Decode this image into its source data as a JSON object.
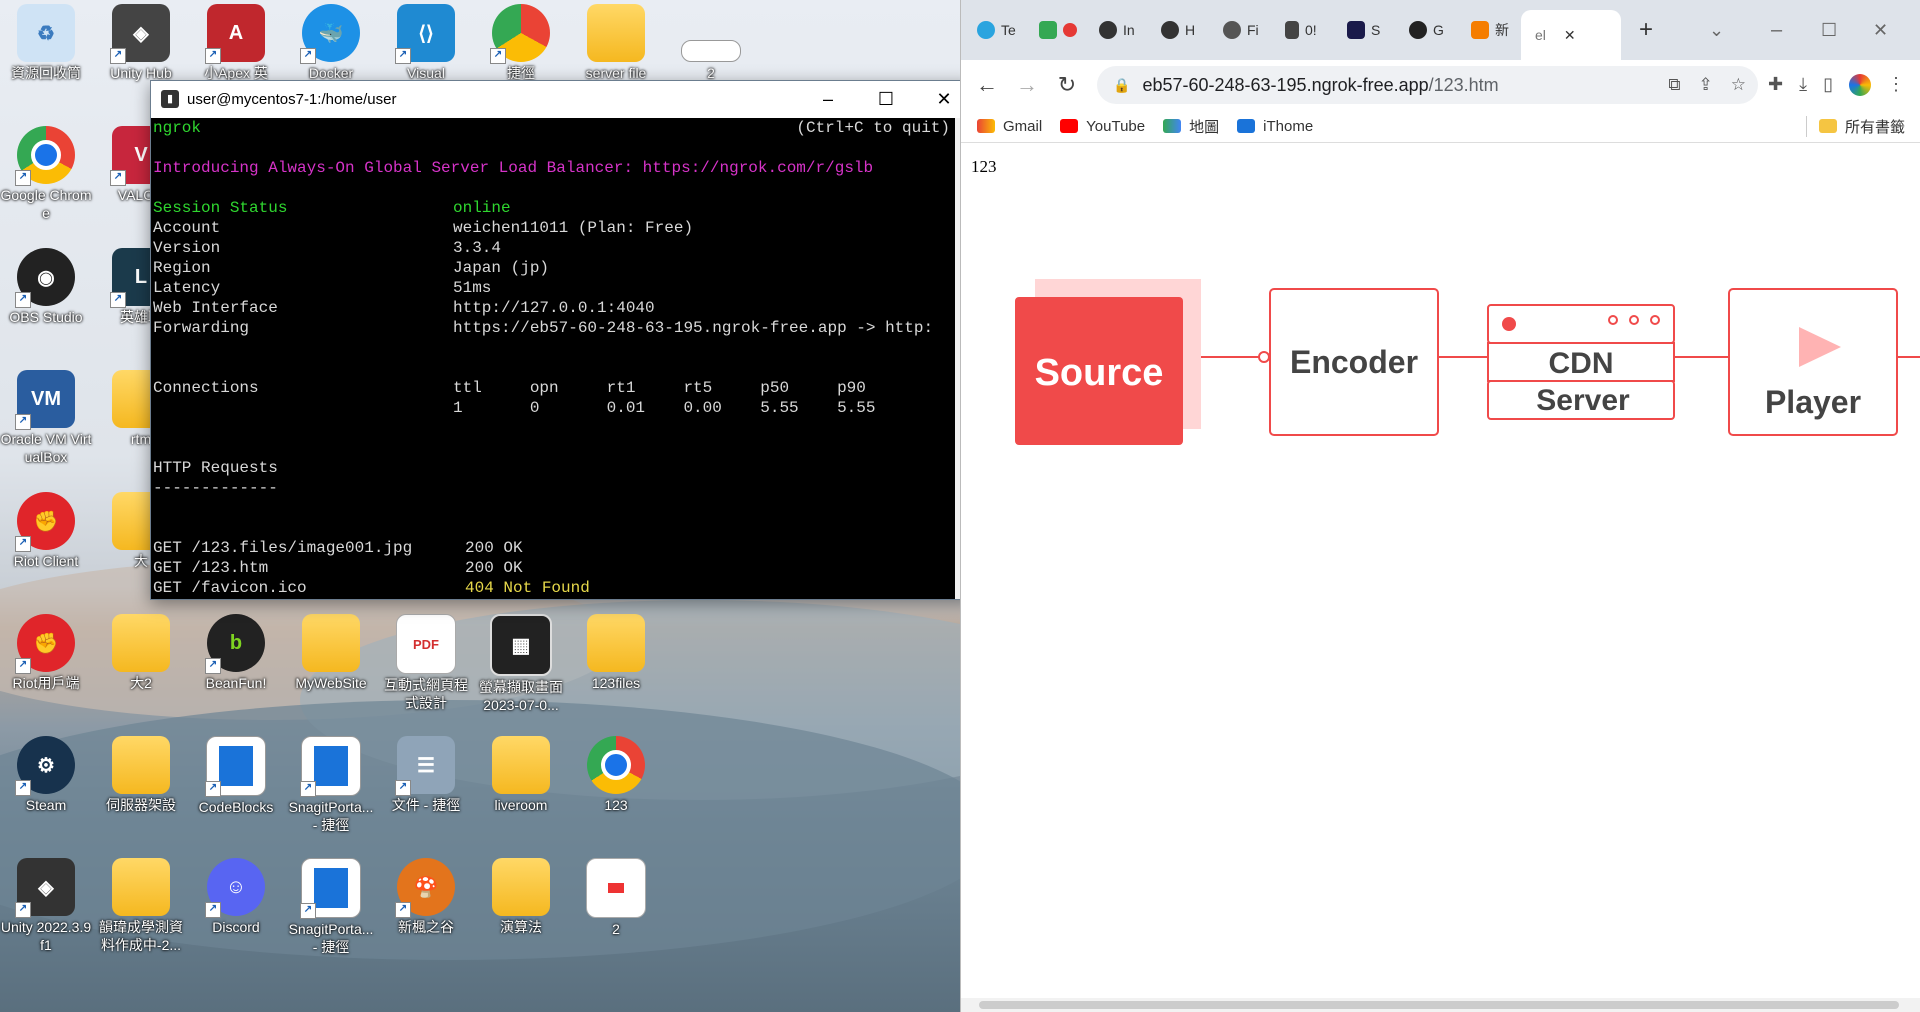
{
  "desktop": {
    "icons": [
      {
        "label": "資源回收筒"
      },
      {
        "label": "Unity Hub"
      },
      {
        "label": "小Apex 英"
      },
      {
        "label": "Docker"
      },
      {
        "label": "Visual"
      },
      {
        "label": "捷徑"
      },
      {
        "label": "server file"
      },
      {
        "label": "2"
      },
      {
        "label": "Google Chrome"
      },
      {
        "label": "VALOR"
      },
      {
        "label": "OBS Studio"
      },
      {
        "label": "英雄聯"
      },
      {
        "label": "Oracle VM VirtualBox"
      },
      {
        "label": "rtm"
      },
      {
        "label": "Riot Client"
      },
      {
        "label": "大"
      },
      {
        "label": "Riot用戶端"
      },
      {
        "label": "大2"
      },
      {
        "label": "BeanFun!"
      },
      {
        "label": "MyWebSite"
      },
      {
        "label": "互動式網頁程式設計"
      },
      {
        "label": "螢幕擷取畫面 2023-07-0..."
      },
      {
        "label": "123files"
      },
      {
        "label": "Steam"
      },
      {
        "label": "伺服器架設"
      },
      {
        "label": "CodeBlocks"
      },
      {
        "label": "SnagitPorta... - 捷徑"
      },
      {
        "label": "文件 - 捷徑"
      },
      {
        "label": "liveroom"
      },
      {
        "label": "123"
      },
      {
        "label": "Unity 2022.3.9f1"
      },
      {
        "label": "韻瑋成學測資料作成中-2..."
      },
      {
        "label": "Discord"
      },
      {
        "label": "SnagitPorta... - 捷徑"
      },
      {
        "label": "新楓之谷"
      },
      {
        "label": "演算法"
      },
      {
        "label": "2"
      }
    ]
  },
  "terminal": {
    "title": "user@mycentos7-1:/home/user",
    "app": "ngrok",
    "quit_hint": "(Ctrl+C to quit)",
    "announcement": "Introducing Always-On Global Server Load Balancer: https://ngrok.com/r/gslb",
    "rows": [
      {
        "k": "Session Status",
        "v": "online"
      },
      {
        "k": "Account",
        "v": "weichen11011 (Plan: Free)"
      },
      {
        "k": "Version",
        "v": "3.3.4"
      },
      {
        "k": "Region",
        "v": "Japan (jp)"
      },
      {
        "k": "Latency",
        "v": "51ms"
      },
      {
        "k": "Web Interface",
        "v": "http://127.0.0.1:4040"
      },
      {
        "k": "Forwarding",
        "v": "https://eb57-60-248-63-195.ngrok-free.app -> http:"
      }
    ],
    "connections_label": "Connections",
    "conn_headers": "ttl     opn     rt1     rt5     p50     p90",
    "conn_values": "1       0       0.01    0.00    5.55    5.55",
    "http_label": "HTTP Requests",
    "http_rule": "-------------",
    "requests": [
      {
        "path": "GET /123.files/image001.jpg",
        "status": "200 OK"
      },
      {
        "path": "GET /123.htm",
        "status": "200 OK"
      },
      {
        "path": "GET /favicon.ico",
        "status": "404 Not Found"
      }
    ]
  },
  "browser": {
    "tabs": [
      "Te",
      "",
      "In",
      "H",
      "Fi",
      "0!",
      "S",
      "G",
      "新",
      "el"
    ],
    "active_tab": "el",
    "url_host": "eb57-60-248-63-195.ngrok-free.app",
    "url_path": "/123.htm",
    "bookmarks": [
      "Gmail",
      "YouTube",
      "地圖",
      "iThome"
    ],
    "all_bookmarks": "所有書籤",
    "page_text": "123",
    "diagram": {
      "source": "Source",
      "encoder": "Encoder",
      "cdn1": "CDN",
      "cdn2": "Server",
      "player": "Player"
    },
    "accent": "#f04a4a"
  }
}
